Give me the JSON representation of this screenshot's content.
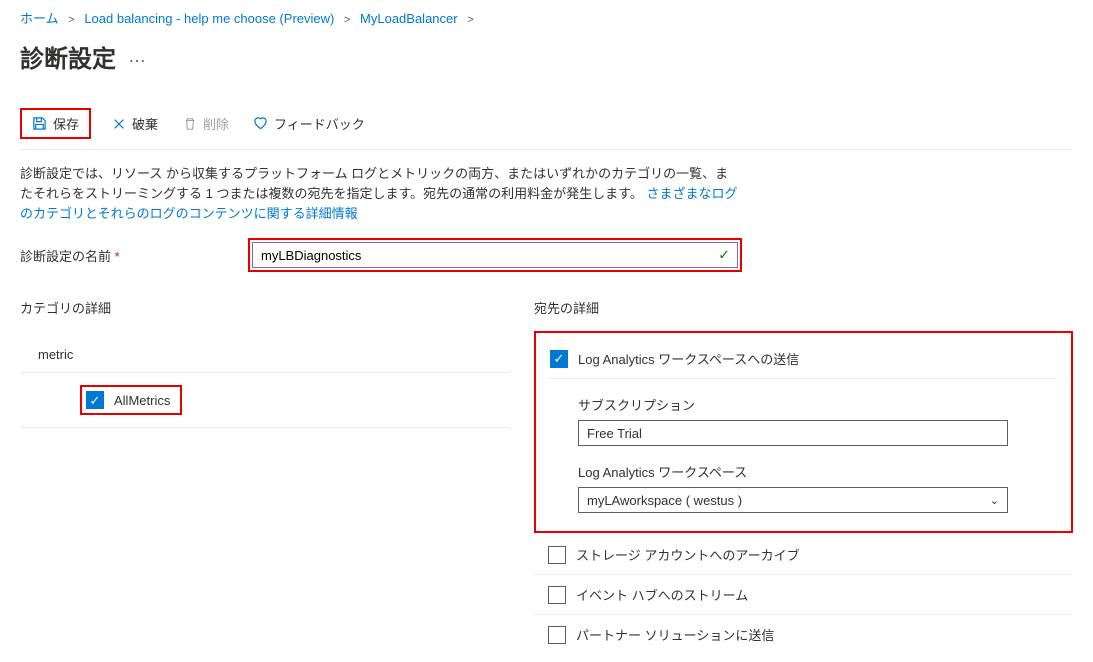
{
  "breadcrumb": {
    "home": "ホーム",
    "item1": "Load balancing - help me choose (Preview)",
    "item2": "MyLoadBalancer"
  },
  "page": {
    "title": "診断設定",
    "more": "…"
  },
  "toolbar": {
    "save": "保存",
    "discard": "破棄",
    "delete": "削除",
    "feedback": "フィードバック"
  },
  "description": {
    "text1": "診断設定では、リソース から収集するプラットフォーム ログとメトリックの両方、またはいずれかのカテゴリの一覧、またそれらをストリーミングする 1 つまたは複数の宛先を指定します。宛先の通常の利用料金が発生します。",
    "link": "さまざまなログのカテゴリとそれらのログのコンテンツに関する詳細情報"
  },
  "nameField": {
    "label": "診断設定の名前",
    "value": "myLBDiagnostics"
  },
  "left": {
    "header": "カテゴリの詳細",
    "group": "metric",
    "items": [
      {
        "label": "AllMetrics",
        "checked": true
      }
    ]
  },
  "right": {
    "header": "宛先の詳細",
    "laSend": {
      "label": "Log Analytics ワークスペースへの送信",
      "checked": true
    },
    "subscription": {
      "label": "サブスクリプション",
      "value": "Free Trial"
    },
    "workspace": {
      "label": "Log Analytics ワークスペース",
      "value": "myLAworkspace ( westus )"
    },
    "others": [
      {
        "label": "ストレージ アカウントへのアーカイブ",
        "checked": false
      },
      {
        "label": "イベント ハブへのストリーム",
        "checked": false
      },
      {
        "label": "パートナー ソリューションに送信",
        "checked": false
      }
    ]
  },
  "colors": {
    "accent": "#0078d4",
    "highlight": "#e60000",
    "valid": "#107c10"
  }
}
